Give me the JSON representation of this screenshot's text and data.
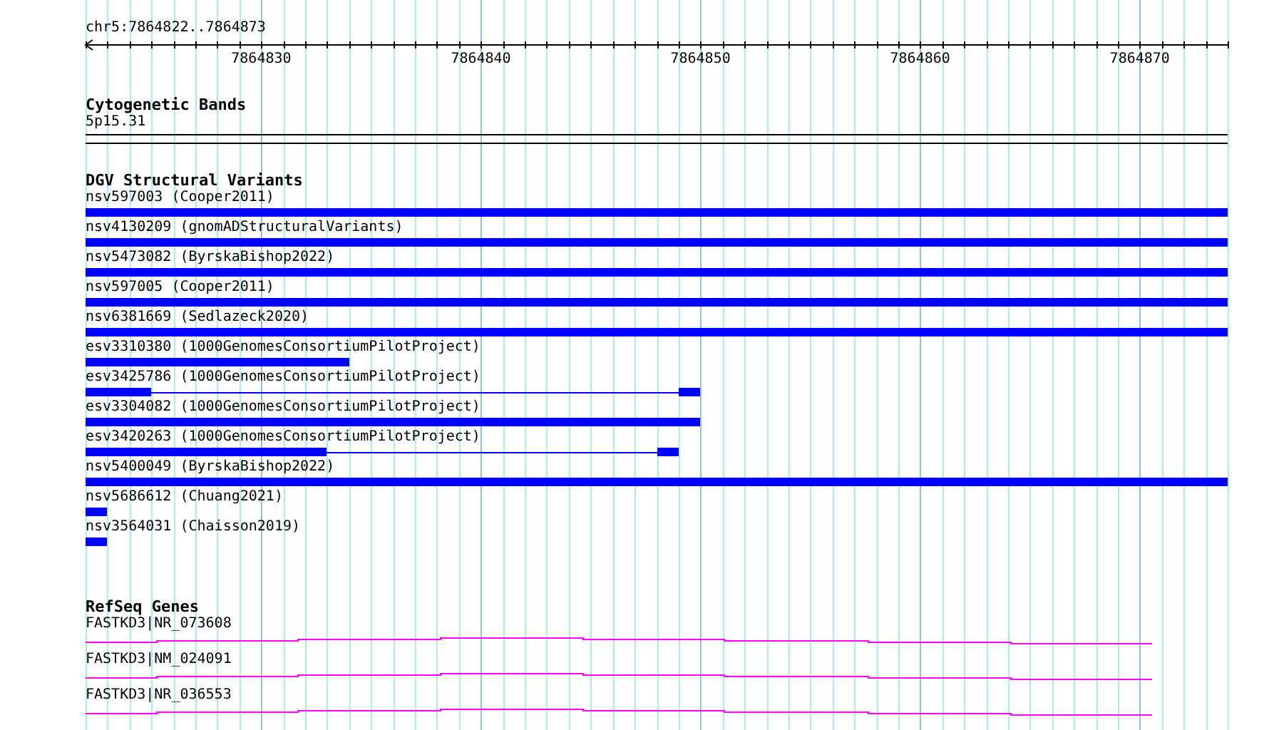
{
  "location": "chr5:7864822..7864873",
  "ruler": {
    "ticks": [
      "7864830",
      "7864840",
      "7864850",
      "7864860",
      "7864870"
    ]
  },
  "tracks": [
    {
      "title": "Cytogenetic Bands",
      "kind": "bands",
      "features": [
        {
          "label": "5p15.31"
        }
      ]
    },
    {
      "title": "DGV Structural Variants",
      "kind": "variants",
      "features": [
        {
          "label": "nsv597003 (Cooper2011)"
        },
        {
          "label": "nsv4130209 (gnomADStructuralVariants)"
        },
        {
          "label": "nsv5473082 (ByrskaBishop2022)"
        },
        {
          "label": "nsv597005 (Cooper2011)"
        },
        {
          "label": "nsv6381669 (Sedlazeck2020)"
        },
        {
          "label": "esv3310380 (1000GenomesConsortiumPilotProject)"
        },
        {
          "label": "esv3425786 (1000GenomesConsortiumPilotProject)"
        },
        {
          "label": "esv3304082 (1000GenomesConsortiumPilotProject)"
        },
        {
          "label": "esv3420263 (1000GenomesConsortiumPilotProject)"
        },
        {
          "label": "nsv5400049 (ByrskaBishop2022)"
        },
        {
          "label": "nsv5686612 (Chuang2021)"
        },
        {
          "label": "nsv3564031 (Chaisson2019)"
        }
      ]
    },
    {
      "title": "RefSeq Genes",
      "kind": "genes",
      "features": [
        {
          "label": "FASTKD3|NR_073608"
        },
        {
          "label": "FASTKD3|NM_024091"
        },
        {
          "label": "FASTKD3|NR_036553"
        }
      ]
    }
  ]
}
